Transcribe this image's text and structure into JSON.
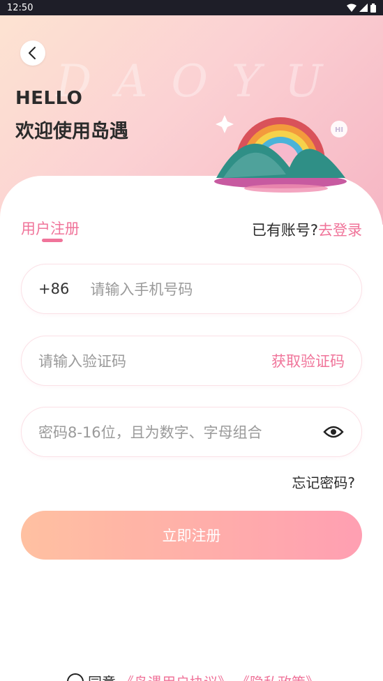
{
  "status_bar": {
    "time": "12:50"
  },
  "hero": {
    "watermark": "DAOYU",
    "hello": "HELLO",
    "welcome": "欢迎使用岛遇",
    "hi_badge": "HI"
  },
  "tabs": {
    "register": "用户注册",
    "has_account": "已有账号?",
    "go_login": "去登录"
  },
  "form": {
    "country_code": "+86",
    "phone_placeholder": "请输入手机号码",
    "code_placeholder": "请输入验证码",
    "get_code": "获取验证码",
    "password_placeholder": "密码8-16位，且为数字、字母组合",
    "forgot_password": "忘记密码?",
    "submit": "立即注册"
  },
  "agreement": {
    "prefix": "同意",
    "user_agreement": "《岛遇用户协议》",
    "privacy_policy": "《隐私政策》"
  },
  "colors": {
    "accent": "#f0749a",
    "button_start": "#ffbd9c",
    "button_end": "#ff9aae"
  }
}
